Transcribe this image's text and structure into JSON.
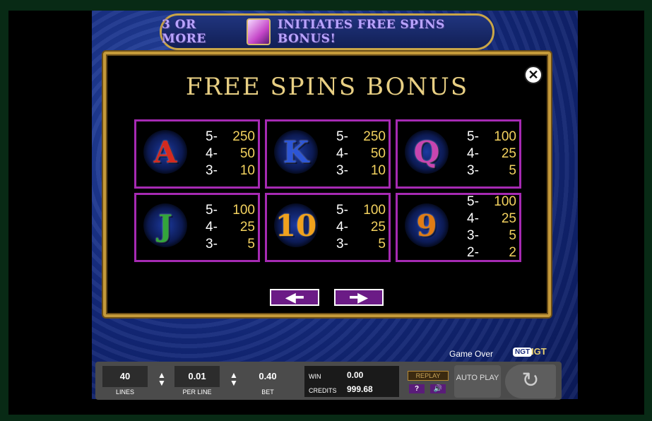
{
  "banner": {
    "left_text": "3 OR MORE",
    "right_text": "INITIATES FREE SPINS BONUS!"
  },
  "panel": {
    "title": "FREE SPINS BONUS",
    "symbols": [
      {
        "glyph": "A",
        "color": "#d42a1f",
        "pays": [
          [
            "5-",
            "250"
          ],
          [
            "4-",
            "50"
          ],
          [
            "3-",
            "10"
          ]
        ]
      },
      {
        "glyph": "K",
        "color": "#2d56d6",
        "pays": [
          [
            "5-",
            "250"
          ],
          [
            "4-",
            "50"
          ],
          [
            "3-",
            "10"
          ]
        ]
      },
      {
        "glyph": "Q",
        "color": "#c845b0",
        "pays": [
          [
            "5-",
            "100"
          ],
          [
            "4-",
            "25"
          ],
          [
            "3-",
            "5"
          ]
        ]
      },
      {
        "glyph": "J",
        "color": "#33a63b",
        "pays": [
          [
            "5-",
            "100"
          ],
          [
            "4-",
            "25"
          ],
          [
            "3-",
            "5"
          ]
        ]
      },
      {
        "glyph": "10",
        "color": "#f0a11d",
        "pays": [
          [
            "5-",
            "100"
          ],
          [
            "4-",
            "25"
          ],
          [
            "3-",
            "5"
          ]
        ]
      },
      {
        "glyph": "9",
        "color": "#e07c15",
        "pays": [
          [
            "5-",
            "100"
          ],
          [
            "4-",
            "25"
          ],
          [
            "3-",
            "5"
          ],
          [
            "2-",
            "2"
          ]
        ]
      }
    ],
    "prev_icon": "left-arrow-icon",
    "next_icon": "right-arrow-icon"
  },
  "status": {
    "game_over": "Game Over",
    "brand1": "NGT",
    "brand2": "IGT"
  },
  "bottom": {
    "lines": {
      "value": "40",
      "label": "LINES"
    },
    "per_line": {
      "value": "0.01",
      "label": "PER LINE"
    },
    "bet": {
      "value": "0.40",
      "label": "BET"
    },
    "win_label": "WIN",
    "win_value": "0.00",
    "credits_label": "CREDITS",
    "credits_value": "999.68",
    "replay": "REPLAY",
    "help": "?",
    "auto": "AUTO PLAY"
  }
}
